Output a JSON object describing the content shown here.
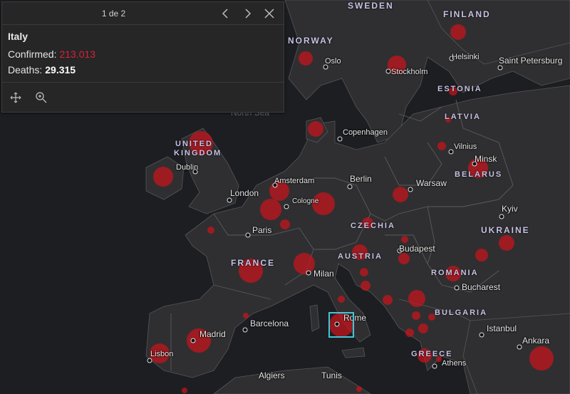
{
  "popup": {
    "pager": "1 de 2",
    "title": "Italy",
    "confirmed_label": "Confirmed:",
    "confirmed_value": "213.013",
    "deaths_label": "Deaths:",
    "deaths_value": "29.315",
    "icons": {
      "prev": "chevron-left-icon",
      "next": "chevron-right-icon",
      "close": "close-icon",
      "pan": "move-icon",
      "zoom": "zoom-in-icon"
    }
  },
  "colors": {
    "bubble": "#c8141c",
    "confirmed": "#d8213a",
    "selection": "#43c6d6",
    "land": "#2f2f31",
    "water": "#1d1e22"
  },
  "countries": [
    "SWEDEN",
    "FINLAND",
    "NORWAY",
    "ESTONIA",
    "LATVIA",
    "UNITED",
    "KINGDOM",
    "BELARUS",
    "CZECHIA",
    "UKRAINE",
    "FRANCE",
    "AUSTRIA",
    "ROMANIA",
    "BULGARIA",
    "GREECE"
  ],
  "cities": [
    "Oslo",
    "Stockholm",
    "Helsinki",
    "Saint Petersburg",
    "Copenhagen",
    "Vilnius",
    "Minsk",
    "Dublin",
    "Amsterdam",
    "London",
    "Berlin",
    "Warsaw",
    "Cologne",
    "Paris",
    "Kyiv",
    "Budapest",
    "Milan",
    "Bucharest",
    "Barcelona",
    "Rome",
    "Istanbul",
    "Madrid",
    "Lisbon",
    "Ankara",
    "Athens",
    "Algiers",
    "Tunis"
  ],
  "seas": [
    "North Sea"
  ]
}
